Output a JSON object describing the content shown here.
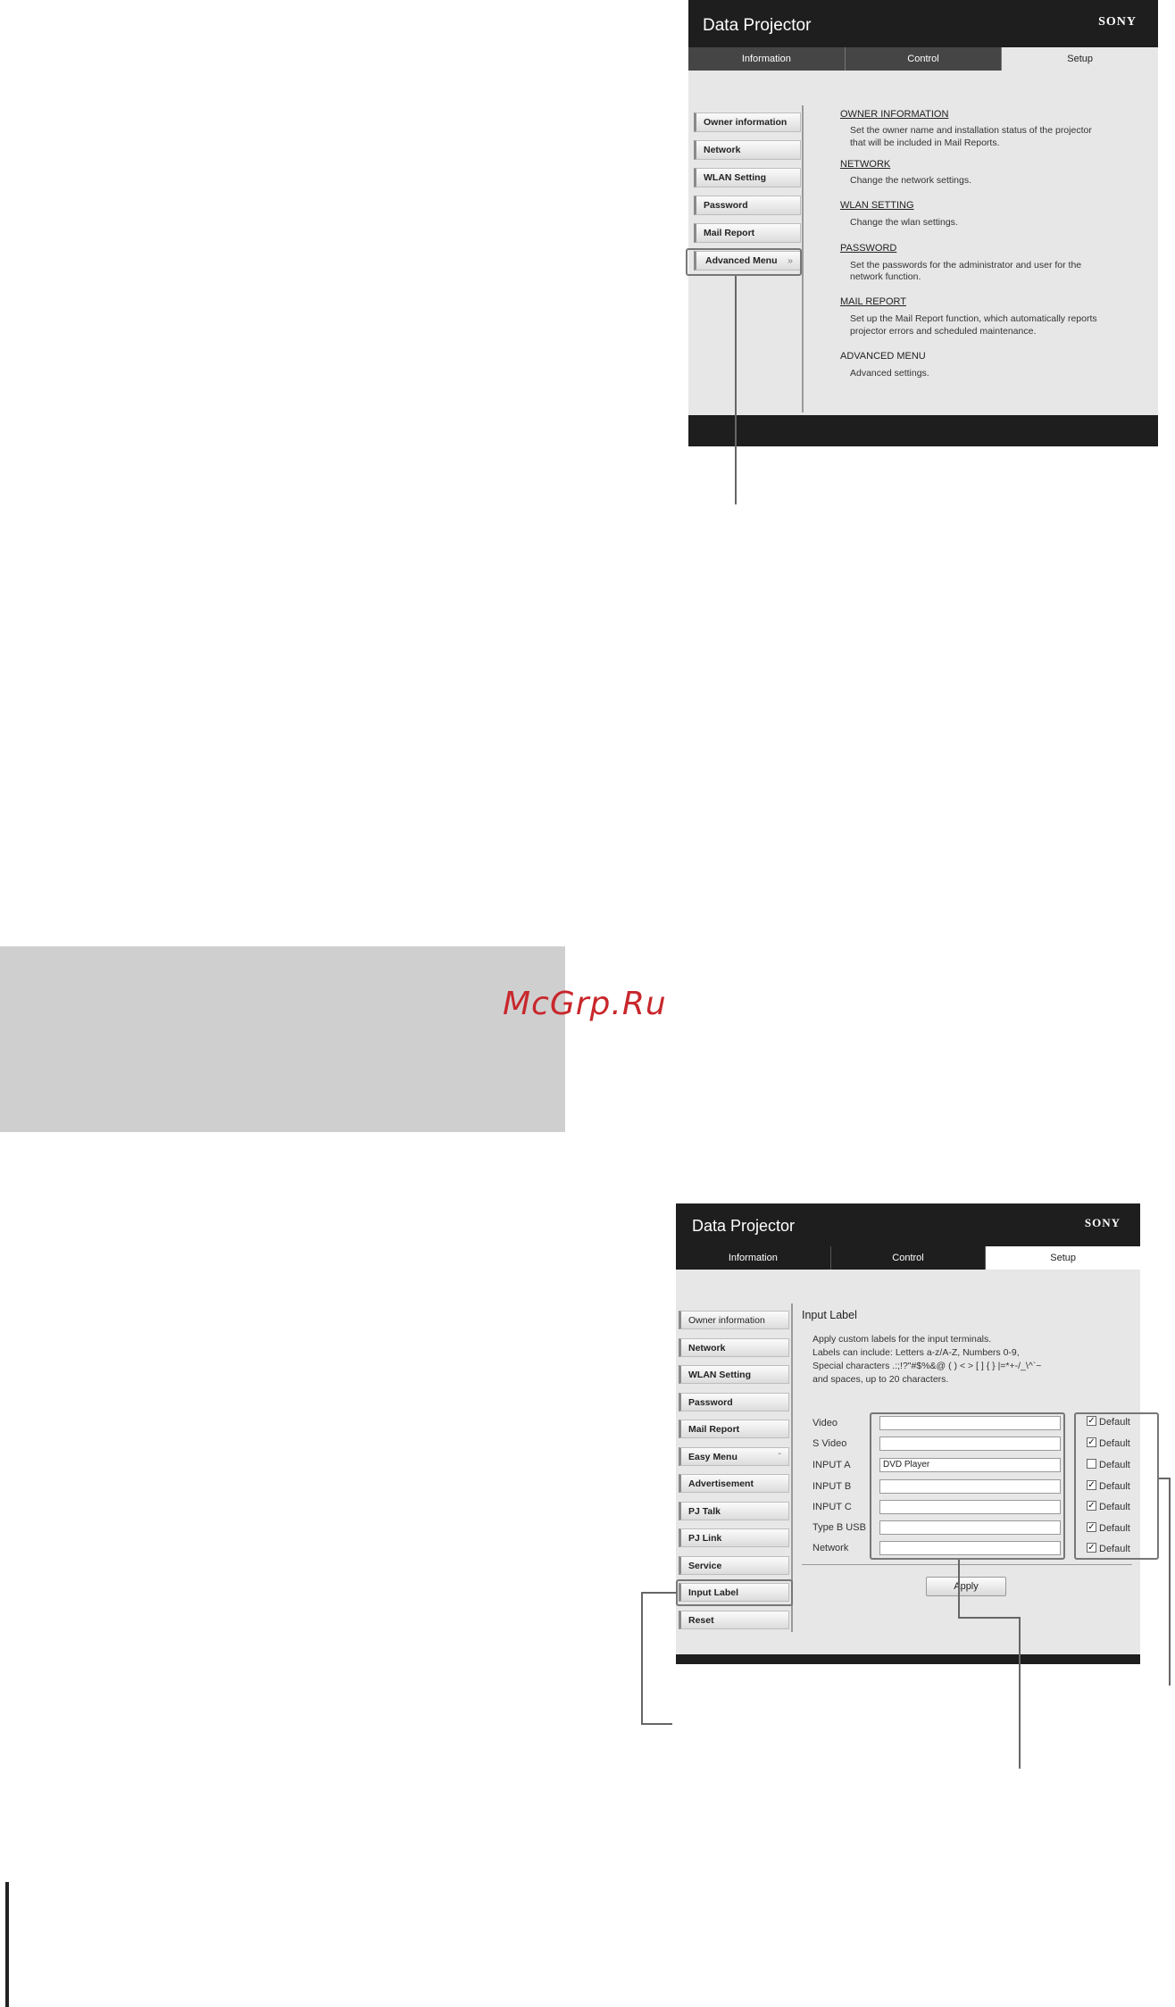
{
  "screen1": {
    "app_title": "Data Projector",
    "brand": "SONY",
    "tabs": [
      "Information",
      "Control",
      "Setup"
    ],
    "sidebar": [
      "Owner information",
      "Network",
      "WLAN Setting",
      "Password",
      "Mail Report",
      "Advanced Menu"
    ],
    "sections": [
      {
        "heading": "OWNER INFORMATION",
        "desc": [
          "Set the owner name and installation status of the projector",
          "that will be included in Mail Reports."
        ]
      },
      {
        "heading": "NETWORK",
        "desc": [
          "Change the network settings."
        ]
      },
      {
        "heading": "WLAN SETTING",
        "desc": [
          "Change the wlan settings."
        ]
      },
      {
        "heading": "PASSWORD",
        "desc": [
          "Set the passwords for the administrator and user for the",
          "network function."
        ]
      },
      {
        "heading": "MAIL REPORT",
        "desc": [
          "Set up the Mail Report function, which automatically reports",
          "projector errors and scheduled maintenance."
        ]
      },
      {
        "heading": "ADVANCED MENU",
        "desc": [
          "Advanced settings."
        ]
      }
    ]
  },
  "watermark": "McGrp.Ru",
  "screen2": {
    "app_title": "Data Projector",
    "brand": "SONY",
    "tabs": [
      "Information",
      "Control",
      "Setup"
    ],
    "sidebar": [
      "Owner information",
      "Network",
      "WLAN Setting",
      "Password",
      "Mail Report",
      "Easy Menu",
      "Advertisement",
      "PJ Talk",
      "PJ Link",
      "Service",
      "Input Label",
      "Reset"
    ],
    "page_title": "Input Label",
    "intro": [
      "Apply custom labels for the input terminals.",
      "Labels can include: Letters a-z/A-Z, Numbers 0-9,",
      "Special characters .:;!?\"#$%&@ ( ) < > [ ] { } |=*+-/_\\^`~",
      "and spaces, up to 20 characters."
    ],
    "fields": [
      {
        "label": "Video",
        "value": "",
        "default_checked": true
      },
      {
        "label": "S Video",
        "value": "",
        "default_checked": true
      },
      {
        "label": "INPUT A",
        "value": "DVD Player",
        "default_checked": false
      },
      {
        "label": "INPUT B",
        "value": "",
        "default_checked": true
      },
      {
        "label": "INPUT C",
        "value": "",
        "default_checked": true
      },
      {
        "label": "Type B USB",
        "value": "",
        "default_checked": true
      },
      {
        "label": "Network",
        "value": "",
        "default_checked": true
      }
    ],
    "default_label": "Default",
    "apply_label": "Apply"
  }
}
